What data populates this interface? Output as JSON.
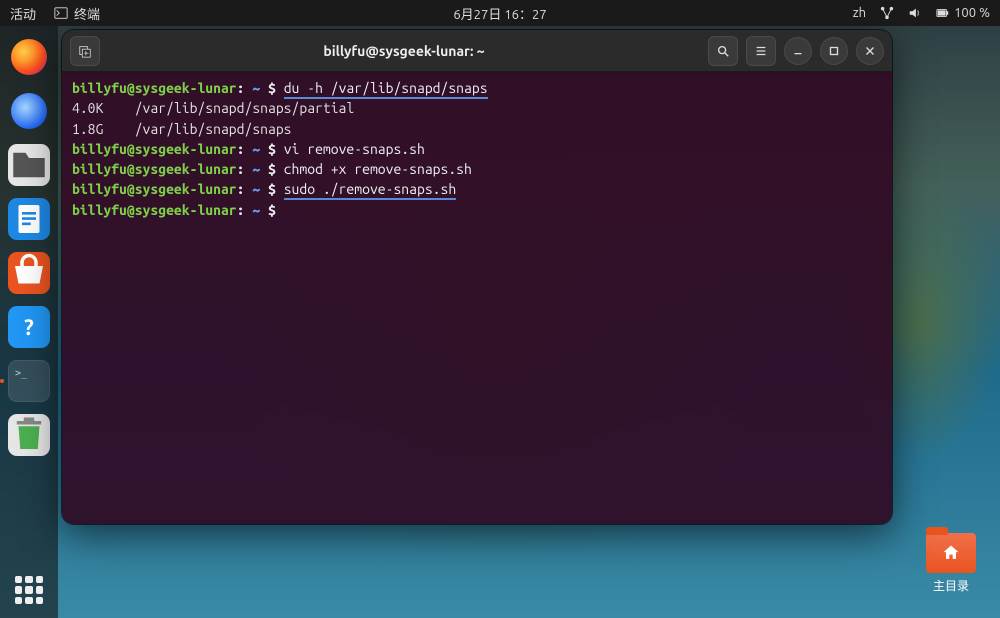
{
  "topbar": {
    "activities": "活动",
    "app_label": "终端",
    "datetime": "6月27日 16：27",
    "input_method": "zh",
    "battery": "100 %"
  },
  "dock": {
    "items": [
      {
        "name": "firefox-icon",
        "label": "Firefox"
      },
      {
        "name": "thunderbird-icon",
        "label": "Thunderbird"
      },
      {
        "name": "files-icon",
        "label": "文件"
      },
      {
        "name": "libreoffice-writer-icon",
        "label": "LibreOffice Writer"
      },
      {
        "name": "ubuntu-software-icon",
        "label": "Ubuntu Software"
      },
      {
        "name": "help-icon",
        "label": "帮助"
      },
      {
        "name": "terminal-icon",
        "label": "终端"
      },
      {
        "name": "trash-icon",
        "label": "回收站"
      }
    ],
    "show_apps": "显示应用程序"
  },
  "desktop": {
    "home_folder_label": "主目录"
  },
  "terminal": {
    "title": "billyfu@sysgeek-lunar: ~",
    "prompt_user": "billyfu@sysgeek-lunar",
    "prompt_path": "~",
    "lines": [
      {
        "type": "cmd",
        "text": "du -h /var/lib/snapd/snaps",
        "underline": true
      },
      {
        "type": "out",
        "text": "4.0K    /var/lib/snapd/snaps/partial"
      },
      {
        "type": "out",
        "text": "1.8G    /var/lib/snapd/snaps"
      },
      {
        "type": "cmd",
        "text": "vi remove-snaps.sh"
      },
      {
        "type": "cmd",
        "text": "chmod +x remove-snaps.sh"
      },
      {
        "type": "cmd",
        "text": "sudo ./remove-snaps.sh",
        "underline": true
      },
      {
        "type": "cmd",
        "text": ""
      }
    ],
    "buttons": {
      "new_tab": "新建标签页",
      "search": "搜索",
      "menu": "菜单",
      "minimize": "最小化",
      "maximize": "最大化",
      "close": "关闭"
    }
  }
}
